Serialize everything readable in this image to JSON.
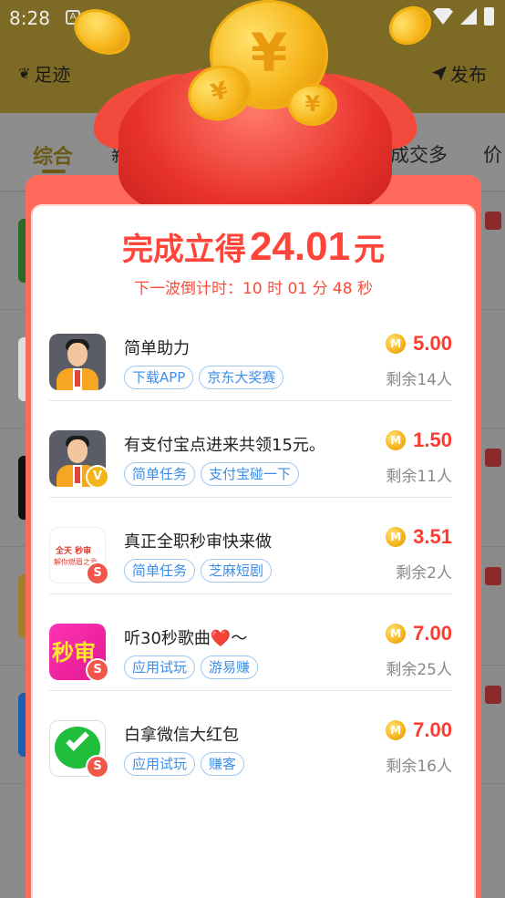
{
  "status": {
    "time": "8:28",
    "notif_icon": "A"
  },
  "appbar": {
    "left_label": "足迹",
    "right_label": "发布"
  },
  "tabs": [
    "综合",
    "新上",
    "成交多",
    "价"
  ],
  "modal": {
    "headline_pre": "完成立得",
    "amount": "24.01",
    "unit": "元",
    "countdown": "下一波倒计时：10 时 01 分 48 秒",
    "coin_symbol": "¥",
    "tasks": [
      {
        "title": "简单助力",
        "tags": [
          "下载APP",
          "京东大奖赛"
        ],
        "reward": "5.00",
        "remaining": "剩余14人",
        "coin": "M"
      },
      {
        "title": "有支付宝点进来共领15元。",
        "tags": [
          "简单任务",
          "支付宝碰一下"
        ],
        "reward": "1.50",
        "remaining": "剩余11人",
        "coin": "M",
        "badge": "V"
      },
      {
        "title": "真正全职秒审快来做",
        "tags": [
          "简单任务",
          "芝麻短剧"
        ],
        "reward": "3.51",
        "remaining": "剩余2人",
        "coin": "M",
        "badge": "S",
        "icon_text_1": "全天 秒审",
        "icon_text_2": "解你燃眉之急"
      },
      {
        "title": "听30秒歌曲❤️～",
        "tags": [
          "应用试玩",
          "游易赚"
        ],
        "reward": "7.00",
        "remaining": "剩余25人",
        "coin": "M",
        "badge": "S",
        "icon_text": "秒审"
      },
      {
        "title": "白拿微信大红包",
        "tags": [
          "应用试玩",
          "赚客"
        ],
        "reward": "7.00",
        "remaining": "剩余16人",
        "coin": "M",
        "badge": "S"
      }
    ]
  },
  "colors": {
    "accent": "#ff4539",
    "tag_blue": "#3d8ee8",
    "appbar": "#7d6a24"
  }
}
